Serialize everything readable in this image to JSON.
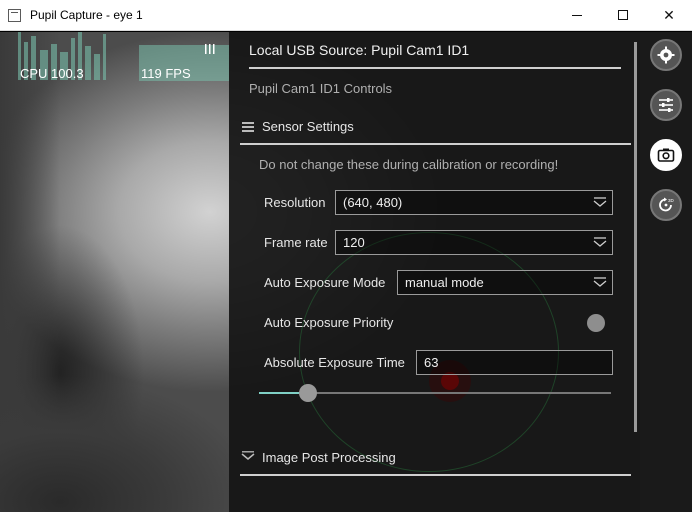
{
  "window": {
    "title": "Pupil Capture - eye 1",
    "minimize_glyph": "",
    "close_glyph": "✕"
  },
  "graphs": {
    "cpu_label": "CPU 100.3",
    "fps_label": "119 FPS",
    "color": "#78beaa"
  },
  "panel": {
    "source_title": "Local USB Source: Pupil Cam1 ID1",
    "controls_title": "Pupil Cam1 ID1 Controls",
    "sensor_section": "Sensor Settings",
    "warning": "Do not change these during calibration or recording!",
    "resolution_label": "Resolution",
    "resolution_value": "(640, 480)",
    "framerate_label": "Frame rate",
    "framerate_value": "120",
    "auto_exposure_mode_label": "Auto Exposure Mode",
    "auto_exposure_mode_value": "manual mode",
    "auto_exposure_priority_label": "Auto Exposure Priority",
    "auto_exposure_priority_on": false,
    "abs_exposure_label": "Absolute Exposure Time",
    "abs_exposure_value": "63",
    "abs_exposure_slider_fraction": 0.12,
    "image_post_section": "Image Post Processing"
  },
  "sidebar_icons": [
    {
      "icon": "gear-icon",
      "active": false
    },
    {
      "icon": "sliders-icon",
      "active": false
    },
    {
      "icon": "camera-icon",
      "active": true
    },
    {
      "icon": "3d-eye-icon",
      "active": false
    }
  ],
  "colors": {
    "accent": "#7fd0c5",
    "panel_bg": "#141414"
  }
}
